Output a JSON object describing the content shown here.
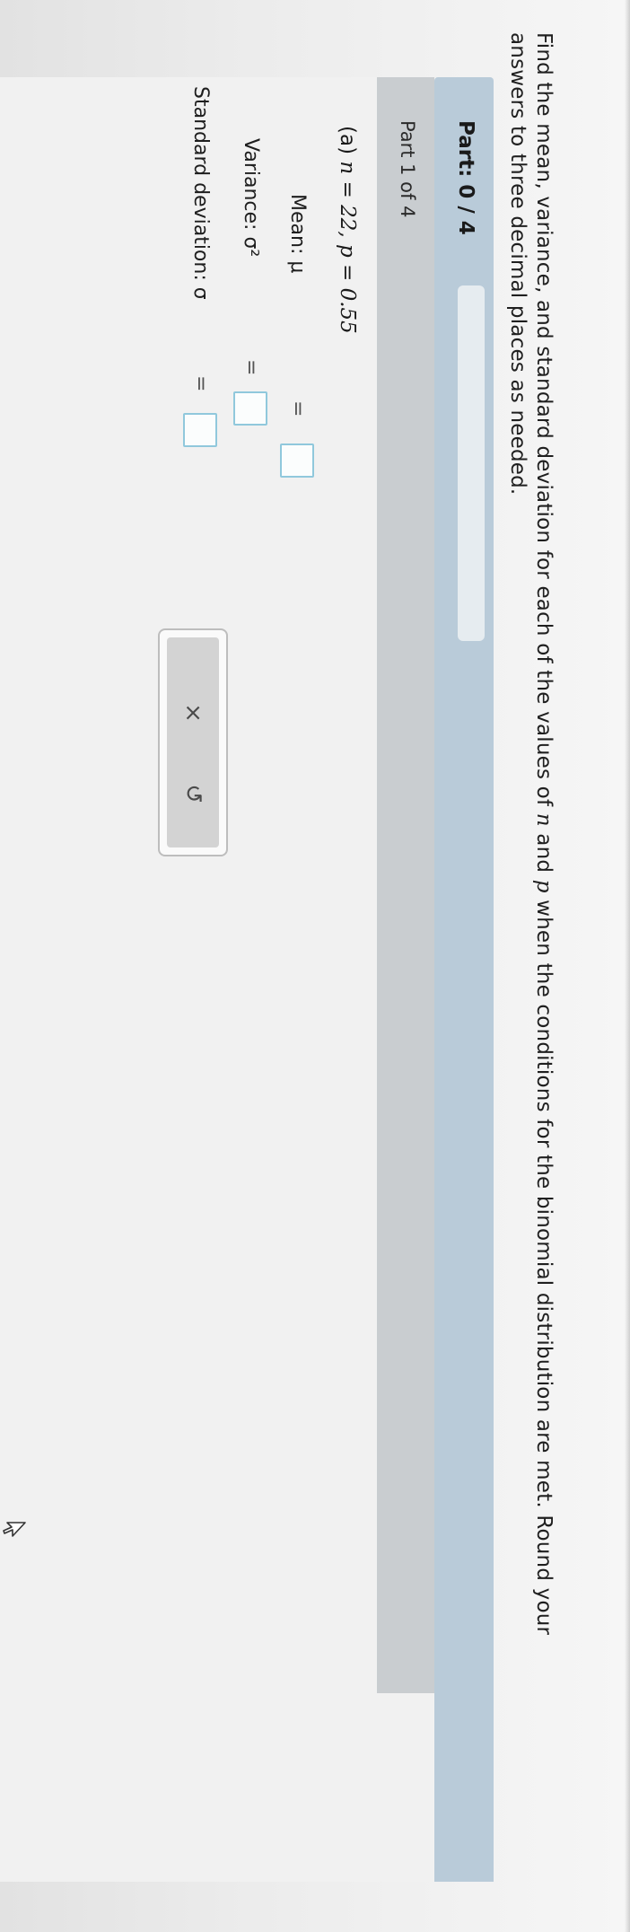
{
  "instructions": {
    "line1_a": "Find the mean, variance, and standard deviation for each of the values of",
    "var_n": "n",
    "and": "and",
    "var_p": "p",
    "line1_b": "when the conditions for the binomial distribution are met. Round your",
    "line2": "answers to three decimal places as needed."
  },
  "progress": {
    "label": "Part: 0 / 4",
    "completed": 0,
    "total": 4
  },
  "part": {
    "label": "Part 1 of 4"
  },
  "problem": {
    "tag": "(a)",
    "math": "n = 22, p = 0.55"
  },
  "answers": [
    {
      "label": "Mean: μ",
      "equals": "=",
      "value": ""
    },
    {
      "label": "Variance: σ²",
      "equals": "=",
      "value": ""
    },
    {
      "label": "Standard deviation: σ",
      "equals": "=",
      "value": ""
    }
  ],
  "keypad": {
    "clear": "×",
    "undo": "↺"
  },
  "icons": {
    "cursor": "mouse-pointer-icon",
    "clear": "close-icon",
    "undo": "undo-icon"
  },
  "colors": {
    "progress_bar": "#b9cbd9",
    "part_header": "#c9cdd0",
    "answer_border": "#90c8dc"
  }
}
